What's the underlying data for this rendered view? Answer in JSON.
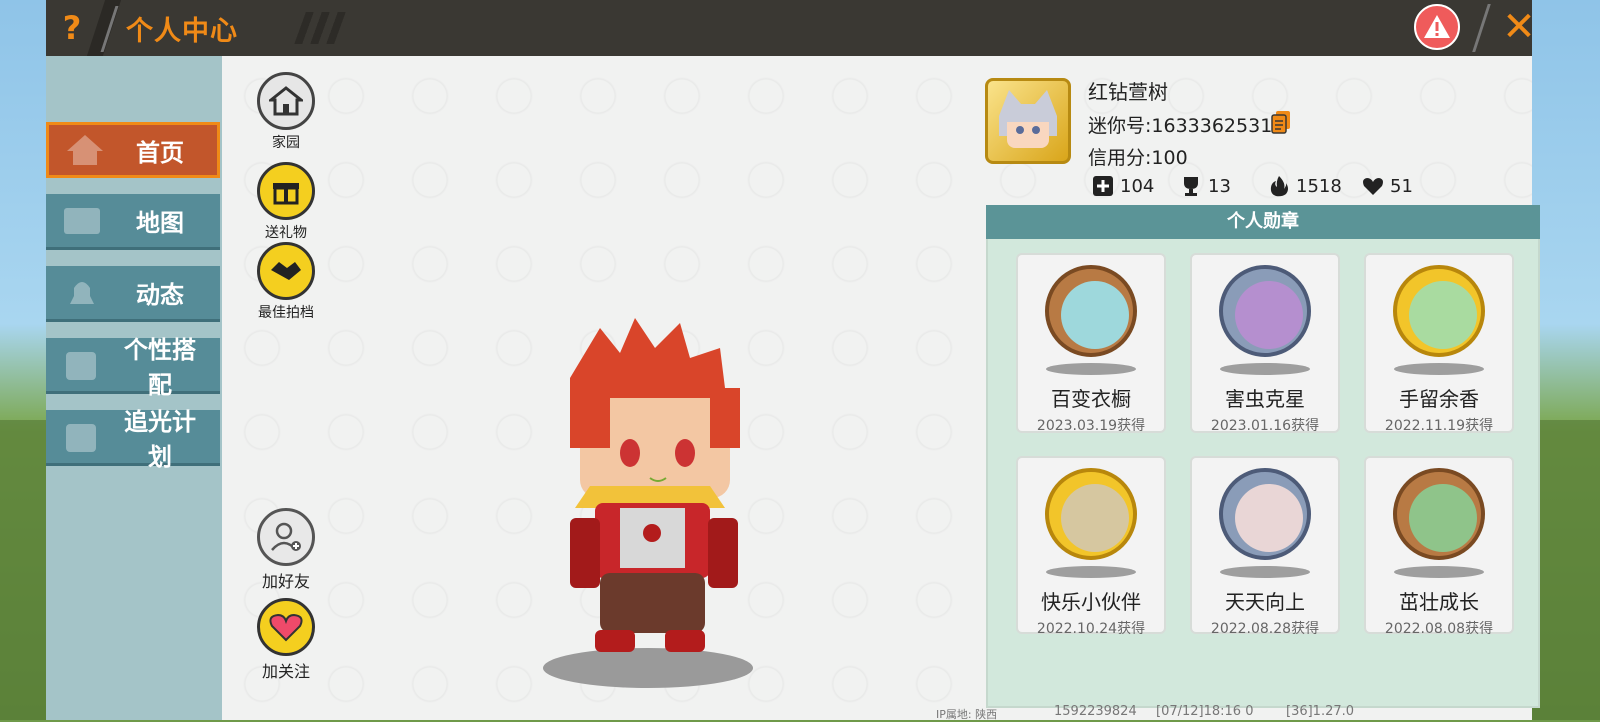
{
  "header": {
    "help_label": "?",
    "title": "个人中心",
    "close_label": "✕"
  },
  "sidebar": {
    "items": [
      {
        "label": "首页",
        "active": true
      },
      {
        "label": "地图",
        "active": false
      },
      {
        "label": "动态",
        "active": false
      },
      {
        "label": "个性搭配",
        "active": false
      },
      {
        "label": "追光计划",
        "active": false
      }
    ]
  },
  "actions": {
    "home": "家园",
    "gift": "送礼物",
    "partner": "最佳拍档",
    "add_friend": "加好友",
    "follow": "加关注"
  },
  "profile": {
    "name": "红钻萱树",
    "mini_id": "迷你号:1633362531",
    "credit": "信用分:100",
    "stats": [
      {
        "icon": "plus-box-icon",
        "value": "104"
      },
      {
        "icon": "trophy-icon",
        "value": "13"
      },
      {
        "icon": "flame-icon",
        "value": "1518"
      },
      {
        "icon": "hearts-icon",
        "value": "51"
      }
    ]
  },
  "badges": {
    "title": "个人勋章",
    "items": [
      {
        "name": "百变衣橱",
        "date": "2023.03.19获得",
        "tier": "bronze"
      },
      {
        "name": "害虫克星",
        "date": "2023.01.16获得",
        "tier": "silver"
      },
      {
        "name": "手留余香",
        "date": "2022.11.19获得",
        "tier": "gold"
      },
      {
        "name": "快乐小伙伴",
        "date": "2022.10.24获得",
        "tier": "gold"
      },
      {
        "name": "天天向上",
        "date": "2022.08.28获得",
        "tier": "silver"
      },
      {
        "name": "茁壮成长",
        "date": "2022.08.08获得",
        "tier": "bronze"
      }
    ]
  },
  "footer": {
    "ip": "IP属地: 陕西",
    "uid": "1592239824",
    "time": "[07/12]18:16 0",
    "version": "[36]1.27.0"
  },
  "colors": {
    "accent": "#f08a17",
    "nav": "#568c98",
    "nav_active": "#c2562b",
    "badge_header": "#5b9497"
  }
}
